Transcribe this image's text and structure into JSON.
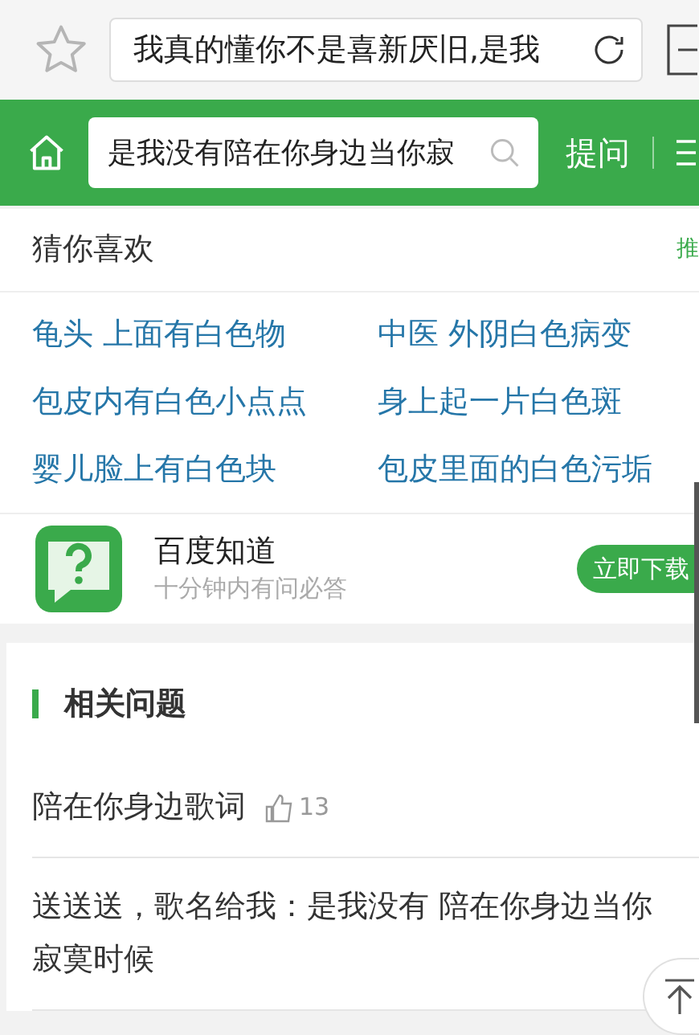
{
  "browser_bar": {
    "url_text": "我真的懂你不是喜新厌旧,是我"
  },
  "header": {
    "search_value": "是我没有陪在你身边当你寂",
    "ask_label": "提问"
  },
  "guess_you_like": {
    "title": "猜你喜欢",
    "side_link": "推",
    "links": [
      "龟头 上面有白色物",
      "中医 外阴白色病变",
      "包皮内有白色小点点",
      "身上起一片白色斑",
      "婴儿脸上有白色块",
      "包皮里面的白色污垢"
    ]
  },
  "app_promo": {
    "name": "百度知道",
    "tagline": "十分钟内有问必答",
    "button": "立即下载"
  },
  "related": {
    "title": "相关问题",
    "questions": [
      {
        "text": "陪在你身边歌词",
        "likes": "13"
      },
      {
        "text": "送送送，歌名给我：是我没有 陪在你身边当你寂寞时候"
      }
    ]
  }
}
